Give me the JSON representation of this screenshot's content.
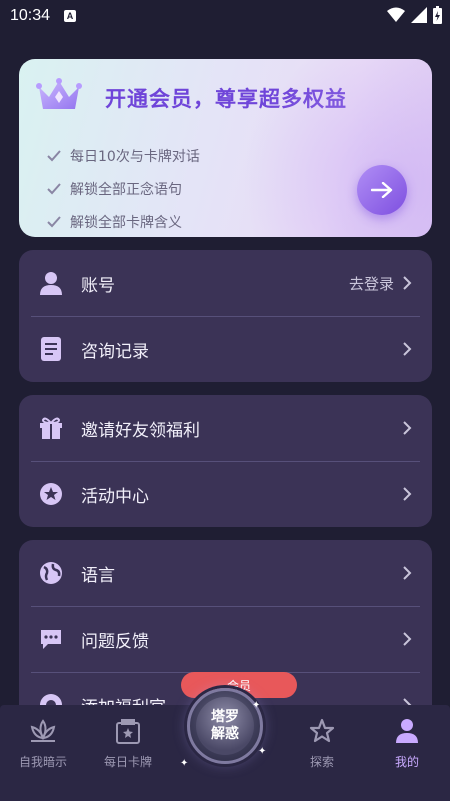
{
  "status_bar": {
    "time": "10:34",
    "notification_letter": "A"
  },
  "vip": {
    "title": "开通会员，尊享超多权益",
    "benefits": [
      "每日10次与卡牌对话",
      "解锁全部正念语句",
      "解锁全部卡牌含义"
    ]
  },
  "account_card": {
    "items": [
      {
        "label": "账号",
        "value": "去登录",
        "icon": "user-icon"
      },
      {
        "label": "咨询记录",
        "icon": "document-icon"
      }
    ]
  },
  "activity_card": {
    "items": [
      {
        "label": "邀请好友领福利",
        "icon": "gift-icon"
      },
      {
        "label": "活动中心",
        "icon": "star-circle-icon"
      }
    ]
  },
  "settings_card": {
    "items": [
      {
        "label": "语言",
        "icon": "globe-icon"
      },
      {
        "label": "问题反馈",
        "icon": "chat-icon"
      },
      {
        "label": "添加福利官",
        "icon": "support-icon",
        "badge": "会员"
      }
    ]
  },
  "bottom_nav": {
    "items": [
      {
        "label": "自我暗示",
        "icon": "lotus-icon",
        "active": false
      },
      {
        "label": "每日卡牌",
        "icon": "card-icon",
        "active": false
      },
      {
        "label": "探索",
        "icon": "star-icon",
        "active": false
      },
      {
        "label": "我的",
        "icon": "profile-icon",
        "active": true
      }
    ],
    "center": {
      "line1": "塔罗",
      "line2": "解惑"
    }
  },
  "colors": {
    "background": "#1f1e33",
    "card": "#3b3356",
    "accent": "#7e4fe0",
    "active_nav": "#c9aaff"
  }
}
